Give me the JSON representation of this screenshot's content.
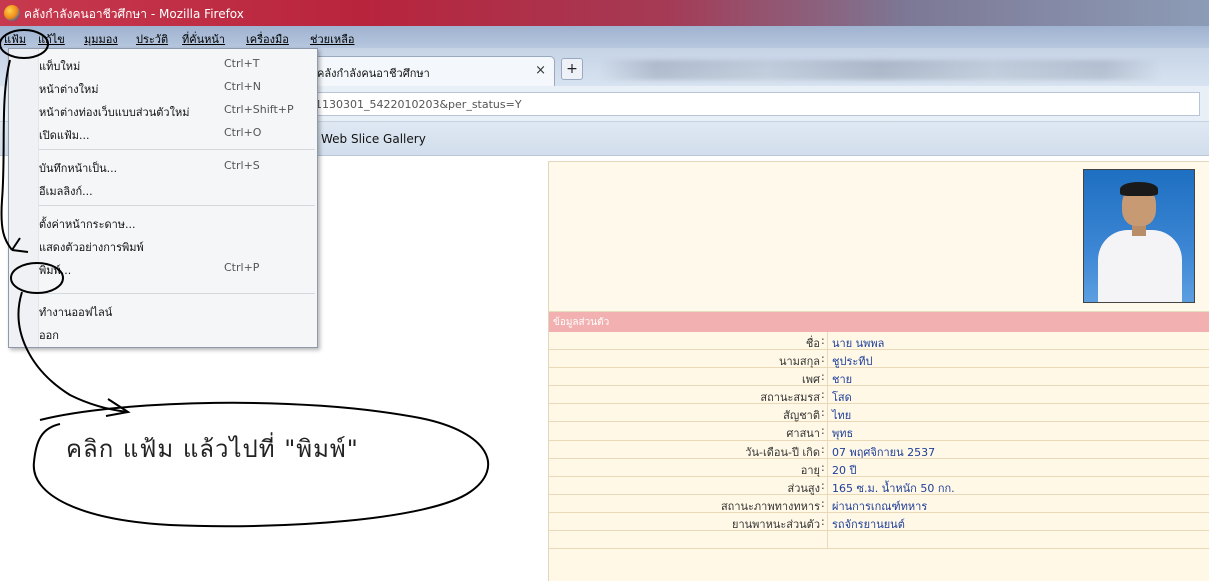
{
  "window": {
    "title": "คลังกำลังคนอาชีวศึกษา - Mozilla Firefox"
  },
  "menubar": {
    "items": [
      {
        "label": "แฟ้ม"
      },
      {
        "label": "แก้ไข"
      },
      {
        "label": "มุมมอง"
      },
      {
        "label": "ประวัติ"
      },
      {
        "label": "ที่คั่นหน้า"
      },
      {
        "label": "เครื่องมือ"
      },
      {
        "label": "ช่วยเหลือ"
      }
    ]
  },
  "tabs": [
    {
      "title": "คลังกำลังคนอาชีวศึกษา",
      "close": "×"
    }
  ],
  "new_tab_label": "+",
  "urlbar": {
    "value": "1130301_5422010203&per_status=Y"
  },
  "bookmarks": {
    "items": [
      {
        "label": "Web Slice Gallery"
      }
    ]
  },
  "file_menu": {
    "items": [
      {
        "label": "แท็บใหม่",
        "shortcut": "Ctrl+T"
      },
      {
        "label": "หน้าต่างใหม่",
        "shortcut": "Ctrl+N"
      },
      {
        "label": "หน้าต่างท่องเว็บแบบส่วนตัวใหม่",
        "shortcut": "Ctrl+Shift+P"
      },
      {
        "label": "เปิดแฟ้ม...",
        "shortcut": "Ctrl+O"
      },
      {
        "label": "บันทึกหน้าเป็น...",
        "shortcut": "Ctrl+S"
      },
      {
        "label": "อีเมลลิงก์...",
        "shortcut": ""
      },
      {
        "label": "ตั้งค่าหน้ากระดาษ...",
        "shortcut": ""
      },
      {
        "label": "แสดงตัวอย่างการพิมพ์",
        "shortcut": ""
      },
      {
        "label": "พิมพ์...",
        "shortcut": "Ctrl+P"
      },
      {
        "label": "ทำงานออฟไลน์",
        "shortcut": ""
      },
      {
        "label": "ออก",
        "shortcut": ""
      }
    ]
  },
  "profile": {
    "section_title": "ข้อมูลส่วนตัว",
    "separator": ":",
    "fields": [
      {
        "label": "ชื่อ",
        "value": "นาย นพพล"
      },
      {
        "label": "นามสกุล",
        "value": "ชูประทีป"
      },
      {
        "label": "เพศ",
        "value": "ชาย"
      },
      {
        "label": "สถานะสมรส",
        "value": "โสด"
      },
      {
        "label": "สัญชาติ",
        "value": "ไทย"
      },
      {
        "label": "ศาสนา",
        "value": "พุทธ"
      },
      {
        "label": "วัน-เดือน-ปี เกิด",
        "value": "07 พฤศจิกายน 2537"
      },
      {
        "label": "อายุ",
        "value": "20 ปี"
      },
      {
        "label": "ส่วนสูง",
        "value": "165 ซ.ม.  น้ำหนัก 50 กก."
      },
      {
        "label": "สถานะภาพทางทหาร",
        "value": "ผ่านการเกณฑ์ทหาร"
      },
      {
        "label": "ยานพาหนะส่วนตัว",
        "value": "รถจักรยานยนต์"
      }
    ]
  },
  "annotation": {
    "text": "คลิก   แฟ้ม   แล้วไปที่   \"พิมพ์\""
  },
  "colors": {
    "titlebar": "#b8243c",
    "section_header": "#f2b0b0",
    "panel": "#fff8e6",
    "value_text": "#1f3f9a"
  }
}
